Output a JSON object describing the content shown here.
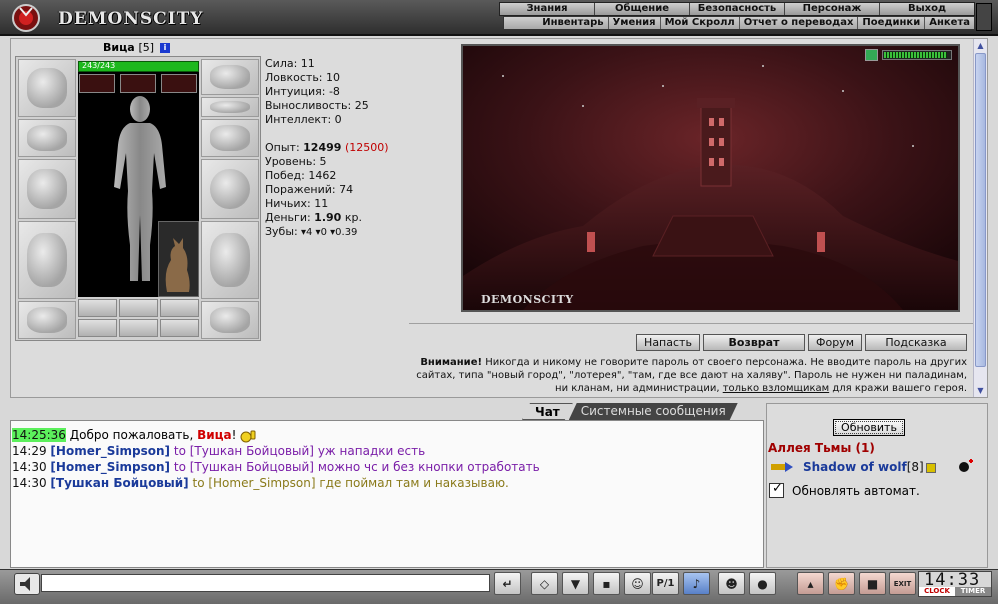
{
  "header": {
    "logo_text": "DEMONSCITY",
    "nav_top": [
      "Знания",
      "Общение",
      "Безопасность",
      "Персонаж",
      "Выход"
    ],
    "nav_sub": [
      "Инвентарь",
      "Умения",
      "Мой Скролл",
      "Отчет о переводах",
      "Поединки",
      "Анкета"
    ]
  },
  "character": {
    "name": "Вица",
    "level": "[5]",
    "hp": "243/243",
    "hp_fraction": 1.0
  },
  "stats": {
    "strength": "Сила: 11",
    "agility": "Ловкость: 10",
    "intuition": "Интуиция: -8",
    "endurance": "Выносливость: 25",
    "intellect": "Интеллект: 0",
    "exp_label": "Опыт:",
    "exp_value": "12499",
    "exp_next": "(12500)",
    "level": "Уровень: 5",
    "wins": "Побед: 1462",
    "losses": "Поражений: 74",
    "draws": "Ничьих: 11",
    "money_label": "Деньги:",
    "money_value": "1.90",
    "money_unit": "кр.",
    "teeth_label": "Зубы:",
    "teeth_1": "4",
    "teeth_2": "0",
    "teeth_3": "0.39"
  },
  "scene": {
    "brand": "DEMONSCITY",
    "meter_fraction": 0.95
  },
  "actions": {
    "attack": "Напасть",
    "return": "Возврат",
    "forum": "Форум",
    "hint": "Подсказка"
  },
  "warning": {
    "bold": "Внимание!",
    "text1": " Никогда и никому не говорите пароль от своего персонажа. Не вводите пароль на других сайтах, типа \"новый город\", \"лотерея\", \"там, где все дают на халяву\". Пароль не нужен ни паладинам, ни кланам, ни администрации, ",
    "link": "только взломщикам",
    "text2": " для кражи вашего героя."
  },
  "chat": {
    "tabs": [
      "Чат",
      "Системные сообщения"
    ],
    "messages": [
      {
        "time": "14:25:36",
        "text": "Добро пожаловать, ",
        "name": "Вица",
        "end": "!"
      },
      {
        "time": "14:29",
        "from": "[Homer_Simpson]",
        "to": "to [Тушкан Бойцовый]",
        "text": " уж нападки есть"
      },
      {
        "time": "14:30",
        "from": "[Homer_Simpson]",
        "to": "to [Тушкан Бойцовый]",
        "text": " можно чс и без кнопки отработать"
      },
      {
        "time": "14:30",
        "from": "[Тушкан Бойцовый]",
        "to": "to [Homer_Simpson]",
        "text": " где поймал там и наказываю."
      }
    ]
  },
  "right_panel": {
    "refresh": "Обновить",
    "location": "Аллея Тьмы (1)",
    "user_name": "Shadow of wolf",
    "user_level": "[8]",
    "auto_refresh": "Обновлять автомат."
  },
  "toolbar": {
    "input_value": "",
    "btn_pl": "P/1",
    "clock_time": "14:33",
    "clock_label": "CLOCK",
    "timer_label": "TIMER"
  }
}
